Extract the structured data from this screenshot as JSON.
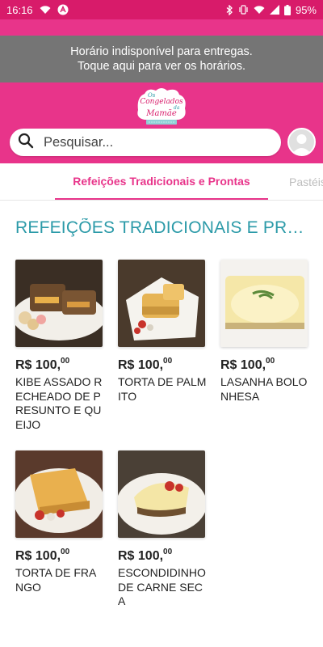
{
  "status_bar": {
    "time": "16:16",
    "battery": "95%"
  },
  "banner": {
    "line1": "Horário indisponível para entregas.",
    "line2": "Toque aqui para ver os horários."
  },
  "logo": {
    "text_top": "Os",
    "text_mid": "Congelados",
    "text_da": "da",
    "text_bottom": "Mamãe"
  },
  "search": {
    "placeholder": "Pesquisar..."
  },
  "tabs": [
    {
      "label": "Refeições Tradicionais e Prontas",
      "active": true
    },
    {
      "label": "Pastéis",
      "active": false
    }
  ],
  "section": {
    "title": "REFEIÇÕES TRADICIONAIS E PRONTAS"
  },
  "products": [
    {
      "price_main": "R$ 100,",
      "price_cents": "00",
      "name": "KIBE ASSADO RECHEADO DE PRESUNTO E QUEIJO"
    },
    {
      "price_main": "R$ 100,",
      "price_cents": "00",
      "name": "TORTA DE PALMITO"
    },
    {
      "price_main": "R$ 100,",
      "price_cents": "00",
      "name": "LASANHA BOLONHESA"
    },
    {
      "price_main": "R$ 100,",
      "price_cents": "00",
      "name": "TORTA DE FRANGO"
    },
    {
      "price_main": "R$ 100,",
      "price_cents": "00",
      "name": "ESCONDIDINHO DE CARNE SECA"
    }
  ],
  "colors": {
    "brand_pink": "#e8348a",
    "section_teal": "#2b9aa8",
    "banner_gray": "#757575"
  }
}
